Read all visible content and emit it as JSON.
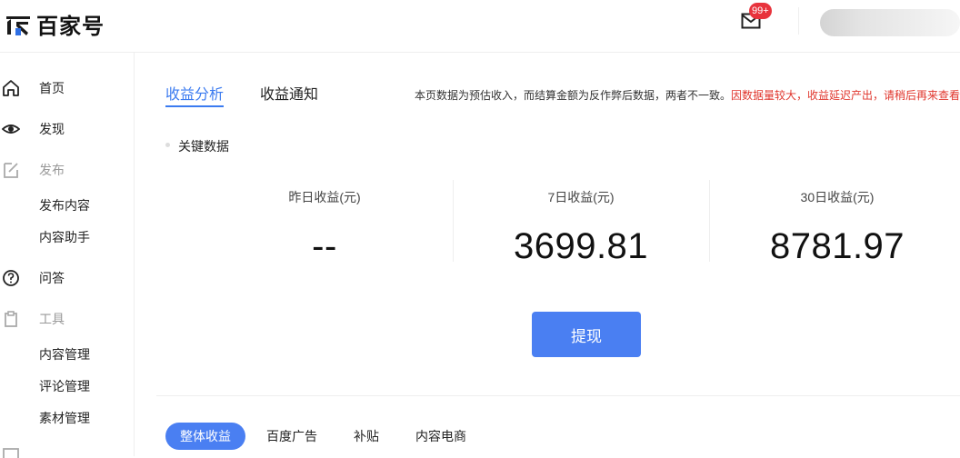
{
  "header": {
    "logo_text": "百家号",
    "mail_badge": "99+"
  },
  "sidebar": {
    "items": [
      {
        "label": "首页",
        "icon": "home-icon"
      },
      {
        "label": "发现",
        "icon": "eye-icon"
      },
      {
        "label": "发布",
        "icon": "edit-icon"
      },
      {
        "label": "发布内容"
      },
      {
        "label": "内容助手"
      },
      {
        "label": "问答",
        "icon": "question-icon"
      },
      {
        "label": "工具",
        "icon": "clipboard-icon"
      },
      {
        "label": "内容管理"
      },
      {
        "label": "评论管理"
      },
      {
        "label": "素材管理"
      }
    ]
  },
  "main": {
    "tabs": [
      "收益分析",
      "收益通知"
    ],
    "notice_main": "本页数据为预估收入，而结算金额为反作弊后数据，两者不一致。",
    "notice_red": "因数据量较大，收益延迟产出，请稍后再来查看",
    "section_title": "关键数据",
    "stats": [
      {
        "label": "昨日收益(元)",
        "value": "--"
      },
      {
        "label": "7日收益(元)",
        "value": "3699.81"
      },
      {
        "label": "30日收益(元)",
        "value": "8781.97"
      }
    ],
    "withdraw_label": "提现",
    "filter_tabs": [
      "整体收益",
      "百度广告",
      "补贴",
      "内容电商"
    ]
  },
  "colors": {
    "accent": "#4a7ff2",
    "badge": "#e8333c",
    "notice_red": "#e0362d"
  }
}
